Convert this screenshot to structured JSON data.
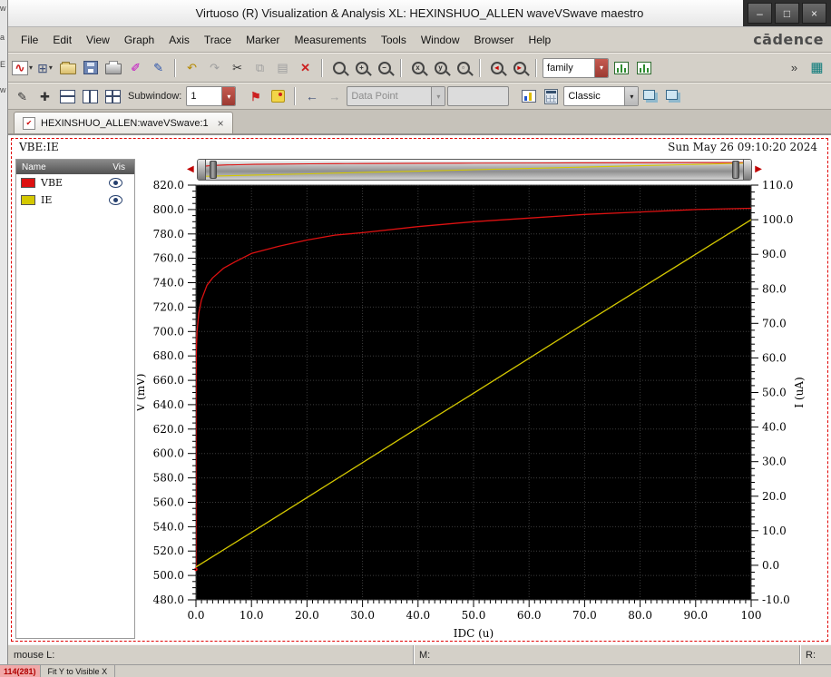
{
  "window": {
    "title": "Virtuoso (R) Visualization & Analysis XL: HEXINSHUO_ALLEN waveVSwave maestro",
    "controls": {
      "minimize": "–",
      "maximize": "□",
      "close": "×"
    }
  },
  "left_sliver": {
    "letters": [
      "w",
      "a",
      "E",
      "w"
    ]
  },
  "menu": {
    "items": [
      "File",
      "Edit",
      "View",
      "Graph",
      "Axis",
      "Trace",
      "Marker",
      "Measurements",
      "Tools",
      "Window",
      "Browser",
      "Help"
    ],
    "logo": "cādence"
  },
  "toolbar1": {
    "family_value": "family",
    "overflow": "»"
  },
  "toolbar2": {
    "subwindow_label": "Subwindow:",
    "subwindow_value": "1",
    "datapoint_placeholder": "Data Point",
    "appearance_value": "Classic"
  },
  "icons": {
    "dropdown": "▾",
    "overflow": "»",
    "wave": "∿",
    "subwin": "⊞",
    "undo": "↶",
    "redo": "↷",
    "cut": "✂",
    "copy": "⧉",
    "paste": "▤",
    "delete": "✕",
    "capture": "✐",
    "pencil": "✎",
    "pan": "✚",
    "flag": "⚑",
    "grid": "▦",
    "plus": "+",
    "minus": "−",
    "letter_x": "x",
    "letter_y": "y",
    "box": "▫",
    "tri_small_left": "◂",
    "tri_small_right": "▸",
    "arrow_left": "←",
    "arrow_right": "→",
    "tri_left": "◀",
    "tri_right": "▶",
    "check": "✔"
  },
  "tab": {
    "label": "HEXINSHUO_ALLEN:waveVSwave:1",
    "close": "×"
  },
  "graph": {
    "title": "VBE:IE",
    "date": "Sun May 26 09:10:20 2024",
    "legend": {
      "name_header": "Name",
      "vis_header": "Vis",
      "items": [
        {
          "label": "VBE",
          "color": "#dd1111"
        },
        {
          "label": "IE",
          "color": "#d4c800"
        }
      ]
    }
  },
  "chart_data": {
    "type": "line",
    "title": "VBE:IE",
    "background": "#000000",
    "grid_color": "#3c3c3c",
    "grid": true,
    "legend_position": "left-panel",
    "x_axis": {
      "title": "IDC (u)",
      "min": 0,
      "max": 100,
      "tick_values": [
        0,
        10,
        20,
        30,
        40,
        50,
        60,
        70,
        80,
        90,
        100
      ],
      "tick_labels": [
        "0.0",
        "10.0",
        "20.0",
        "30.0",
        "40.0",
        "50.0",
        "60.0",
        "70.0",
        "80.0",
        "90.0",
        "100"
      ],
      "minor_per_major": 10
    },
    "y_left": {
      "title": "V (mV)",
      "min": 480,
      "max": 820,
      "tick_values": [
        480,
        500,
        520,
        540,
        560,
        580,
        600,
        620,
        640,
        660,
        680,
        700,
        720,
        740,
        760,
        780,
        800,
        820
      ],
      "tick_labels": [
        "480.0",
        "500.0",
        "520.0",
        "540.0",
        "560.0",
        "580.0",
        "600.0",
        "620.0",
        "640.0",
        "660.0",
        "680.0",
        "700.0",
        "720.0",
        "740.0",
        "760.0",
        "780.0",
        "800.0",
        "820.0"
      ],
      "minor_per_major": 4
    },
    "y_right": {
      "title": "I (uA)",
      "min": -10,
      "max": 110,
      "tick_values": [
        -10,
        0,
        10,
        20,
        30,
        40,
        50,
        60,
        70,
        80,
        90,
        100,
        110
      ],
      "tick_labels": [
        "-10.0",
        "0.0",
        "10.0",
        "20.0",
        "30.0",
        "40.0",
        "50.0",
        "60.0",
        "70.0",
        "80.0",
        "90.0",
        "100.0",
        "110.0"
      ],
      "minor_per_major": 5
    },
    "series": [
      {
        "name": "VBE",
        "unit": "mV",
        "axis": "left",
        "color": "#dd1111",
        "points": [
          [
            0,
            505
          ],
          [
            0.001,
            615
          ],
          [
            0.002,
            626
          ],
          [
            0.005,
            641
          ],
          [
            0.01,
            652
          ],
          [
            0.02,
            663
          ],
          [
            0.05,
            678
          ],
          [
            0.1,
            689
          ],
          [
            0.2,
            700
          ],
          [
            0.5,
            715
          ],
          [
            1,
            726
          ],
          [
            2,
            738
          ],
          [
            3,
            744
          ],
          [
            5,
            752
          ],
          [
            7,
            757
          ],
          [
            10,
            764
          ],
          [
            15,
            770
          ],
          [
            20,
            775
          ],
          [
            25,
            779
          ],
          [
            30,
            781
          ],
          [
            40,
            786
          ],
          [
            50,
            790
          ],
          [
            60,
            793
          ],
          [
            70,
            796
          ],
          [
            80,
            798
          ],
          [
            90,
            800
          ],
          [
            100,
            801
          ]
        ]
      },
      {
        "name": "IE",
        "unit": "uA",
        "axis": "right",
        "color": "#d4c800",
        "points": [
          [
            0,
            -0.5
          ],
          [
            10,
            9.5
          ],
          [
            20,
            19.6
          ],
          [
            30,
            29.7
          ],
          [
            40,
            39.8
          ],
          [
            50,
            49.8
          ],
          [
            60,
            59.9
          ],
          [
            70,
            70
          ],
          [
            80,
            80
          ],
          [
            90,
            90
          ],
          [
            100,
            100
          ]
        ]
      }
    ]
  },
  "statusbar": {
    "left": "mouse L:",
    "middle": "M:",
    "right": "R:"
  },
  "bottombar": {
    "count": "114(281)",
    "hint": "Fit Y to Visible X"
  }
}
